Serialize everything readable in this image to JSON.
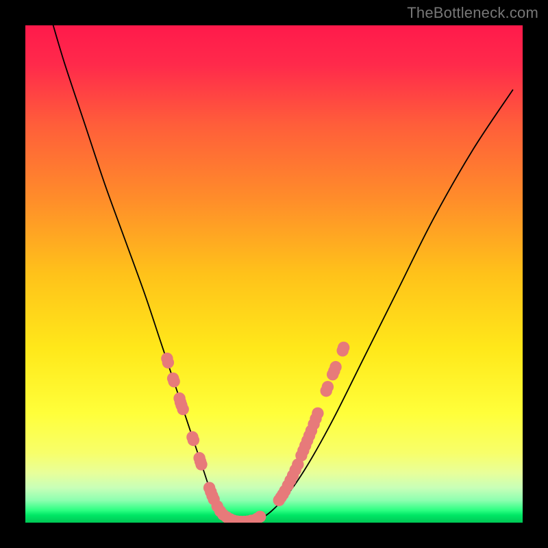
{
  "watermark": "TheBottleneck.com",
  "chart_data": {
    "type": "line",
    "title": "",
    "xlabel": "",
    "ylabel": "",
    "xlim": [
      0,
      100
    ],
    "ylim": [
      0,
      100
    ],
    "gradient_stops": [
      {
        "offset": 0.0,
        "color": "#ff1a4b"
      },
      {
        "offset": 0.08,
        "color": "#ff2a4b"
      },
      {
        "offset": 0.2,
        "color": "#ff5e3a"
      },
      {
        "offset": 0.35,
        "color": "#ff8d2a"
      },
      {
        "offset": 0.5,
        "color": "#ffc21a"
      },
      {
        "offset": 0.65,
        "color": "#ffe81a"
      },
      {
        "offset": 0.78,
        "color": "#ffff3a"
      },
      {
        "offset": 0.86,
        "color": "#f8ff6a"
      },
      {
        "offset": 0.9,
        "color": "#e8ff9a"
      },
      {
        "offset": 0.93,
        "color": "#c8ffb8"
      },
      {
        "offset": 0.955,
        "color": "#8dffb0"
      },
      {
        "offset": 0.975,
        "color": "#2dff82"
      },
      {
        "offset": 0.985,
        "color": "#00e765"
      },
      {
        "offset": 1.0,
        "color": "#00c755"
      }
    ],
    "series": [
      {
        "name": "bottleneck-curve",
        "x": [
          5.6,
          8,
          12,
          16,
          20,
          24,
          27,
          29,
          31,
          33,
          34.5,
          36,
          37,
          38,
          39,
          40,
          42,
          44,
          46,
          48,
          50,
          53,
          57,
          62,
          68,
          75,
          82,
          90,
          98
        ],
        "y": [
          100,
          92,
          80,
          68,
          57,
          46,
          37,
          31,
          25,
          19,
          14.5,
          10,
          7,
          4.5,
          2.8,
          1.6,
          0.6,
          0.2,
          0.4,
          1.2,
          2.8,
          6,
          12,
          21,
          33,
          47,
          61,
          75,
          87
        ]
      }
    ],
    "points": {
      "color": "#e77a7a",
      "radius": 1.2,
      "xy": [
        [
          28.5,
          33.0
        ],
        [
          28.7,
          32.2
        ],
        [
          29.7,
          29.0
        ],
        [
          29.9,
          28.4
        ],
        [
          31.0,
          25.0
        ],
        [
          31.2,
          24.2
        ],
        [
          31.4,
          23.6
        ],
        [
          31.7,
          22.8
        ],
        [
          33.6,
          17.2
        ],
        [
          33.8,
          16.6
        ],
        [
          35.0,
          13.0
        ],
        [
          35.2,
          12.3
        ],
        [
          35.4,
          11.7
        ],
        [
          37.0,
          7.0
        ],
        [
          37.3,
          6.2
        ],
        [
          37.6,
          5.4
        ],
        [
          37.9,
          4.7
        ],
        [
          38.6,
          3.3
        ],
        [
          39.2,
          2.3
        ],
        [
          39.8,
          1.6
        ],
        [
          40.5,
          1.1
        ],
        [
          41.2,
          0.7
        ],
        [
          41.9,
          0.4
        ],
        [
          42.6,
          0.25
        ],
        [
          43.3,
          0.2
        ],
        [
          44.0,
          0.2
        ],
        [
          44.7,
          0.25
        ],
        [
          45.4,
          0.4
        ],
        [
          46.0,
          0.5
        ],
        [
          46.6,
          0.8
        ],
        [
          47.2,
          1.2
        ],
        [
          51.0,
          4.5
        ],
        [
          51.4,
          5.1
        ],
        [
          51.8,
          5.7
        ],
        [
          52.2,
          6.4
        ],
        [
          52.8,
          7.5
        ],
        [
          53.3,
          8.5
        ],
        [
          53.8,
          9.5
        ],
        [
          54.3,
          10.6
        ],
        [
          54.8,
          11.7
        ],
        [
          55.5,
          13.5
        ],
        [
          55.9,
          14.5
        ],
        [
          56.3,
          15.5
        ],
        [
          56.7,
          16.5
        ],
        [
          57.1,
          17.5
        ],
        [
          57.5,
          18.5
        ],
        [
          58.0,
          19.8
        ],
        [
          58.4,
          20.9
        ],
        [
          58.8,
          22.0
        ],
        [
          60.5,
          26.5
        ],
        [
          60.8,
          27.3
        ],
        [
          61.8,
          29.8
        ],
        [
          62.1,
          30.5
        ],
        [
          62.4,
          31.3
        ],
        [
          63.8,
          34.6
        ],
        [
          64.0,
          35.2
        ]
      ]
    }
  }
}
